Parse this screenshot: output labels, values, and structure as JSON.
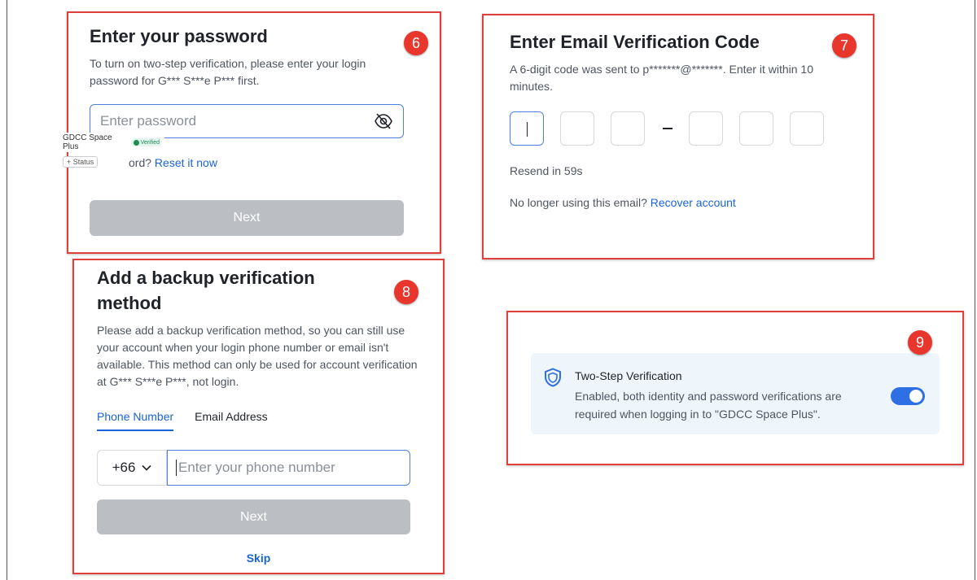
{
  "step6": {
    "badge": "6",
    "title": "Enter your password",
    "description": "To turn on two-step verification, please enter your login password for G*** S***e P*** first.",
    "password_placeholder": "Enter password",
    "forgot_prefix": "ord?",
    "reset_link": "Reset it now",
    "next_label": "Next"
  },
  "overlay": {
    "app_name": "GDCC Space Plus",
    "verified_label": "Verified",
    "status_label": "+ Status"
  },
  "step7": {
    "badge": "7",
    "title": "Enter Email Verification Code",
    "description": "A 6-digit code was sent to p*******@*******. Enter it within 10 minutes.",
    "resend_text": "Resend in 59s",
    "no_longer_text": "No longer using this email?",
    "recover_link": "Recover account"
  },
  "step8": {
    "badge": "8",
    "title": "Add a backup verification method",
    "description": "Please add a backup verification method, so you can still use your account when your login phone number or email isn't available. This method can only be used for account verification at G*** S***e P***, not login.",
    "tabs": [
      {
        "label": "Phone Number",
        "active": true
      },
      {
        "label": "Email Address",
        "active": false
      }
    ],
    "country_code": "+66",
    "phone_placeholder": "Enter your phone number",
    "next_label": "Next",
    "skip_label": "Skip"
  },
  "step9": {
    "badge": "9",
    "title": "Two-Step Verification",
    "description": "Enabled, both identity and password verifications are required when logging in to \"GDCC Space Plus\".",
    "enabled": true
  },
  "colors": {
    "accent": "#1a63d8",
    "highlight_border": "#e0403a",
    "badge": "#e8362d",
    "disabled_button": "#bbbec3",
    "toggle_on": "#2f6fe4"
  },
  "icons": {
    "eye_off": "eye-off-icon",
    "chevron": "chevron-down-icon",
    "shield": "shield-icon"
  }
}
